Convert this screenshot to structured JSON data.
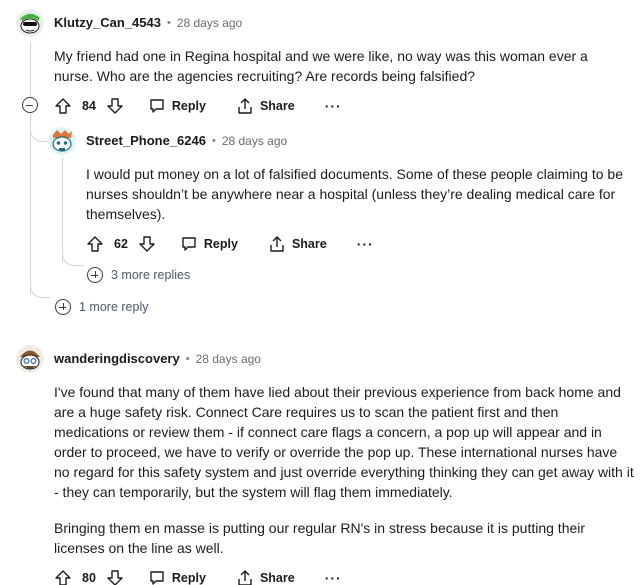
{
  "comments": [
    {
      "username": "Klutzy_Can_4543",
      "separator": "•",
      "time": "28 days ago",
      "body": "My friend had one in Regina hospital and we were like, no way was this woman ever a nurse. Who are the agencies recruiting? Are records being falsified?",
      "votes": "84",
      "reply_label": "Reply",
      "share_label": "Share",
      "more_label": "···",
      "more_replies": "1 more reply",
      "reply": {
        "username": "Street_Phone_6246",
        "separator": "•",
        "time": "28 days ago",
        "body": "I would put money on a lot of falsified documents. Some of these people claiming to be nurses shouldn’t be anywhere near a hospital (unless they’re dealing medical care for themselves).",
        "votes": "62",
        "reply_label": "Reply",
        "share_label": "Share",
        "more_label": "···",
        "more_replies": "3 more replies"
      }
    },
    {
      "username": "wanderingdiscovery",
      "separator": "•",
      "time": "28 days ago",
      "body_p1": "I've found that many of them have lied about their previous experience from back home and are a huge safety risk. Connect Care requires us to scan the patient first and then medications or review them - if connect care flags a concern, a pop up will appear and in order to proceed, we have to verify or override the pop up. These international nurses have no regard for this safety system and just override everything thinking they can get away with it - they can temporarily, but the system will flag them immediately.",
      "body_p2": "Bringing them en masse is putting our regular RN's in stress because it is putting their licenses on the line as well.",
      "votes": "80",
      "reply_label": "Reply",
      "share_label": "Share",
      "more_label": "···"
    }
  ],
  "icons": [
    "avatar-snoo-green",
    "avatar-snoo-teal",
    "avatar-snoo-brown",
    "upvote-icon",
    "downvote-icon",
    "reply-icon",
    "share-icon",
    "collapse-icon",
    "expand-icon"
  ]
}
